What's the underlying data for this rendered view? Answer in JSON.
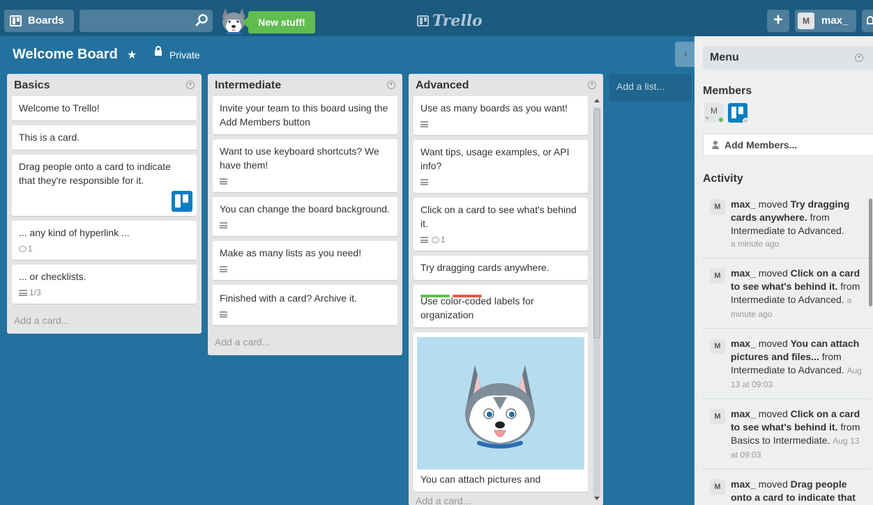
{
  "header": {
    "boards_label": "Boards",
    "new_stuff_label": "New stuff!",
    "logo_text": "Trello",
    "plus_label": "+",
    "user_initial": "M",
    "username": "max_"
  },
  "board": {
    "title": "Welcome Board",
    "star_icon": "★",
    "privacy": "Private",
    "collapse_icon": "›"
  },
  "lists": [
    {
      "title": "Basics",
      "cards": [
        {
          "title": "Welcome to Trello!"
        },
        {
          "title": "This is a card."
        },
        {
          "title": "Drag people onto a card to indicate that they're responsible for it."
        },
        {
          "title": "... any kind of hyperlink ...",
          "comments": "1"
        },
        {
          "title": "... or checklists.",
          "checklist": "1/3"
        }
      ],
      "add_card": "Add a card..."
    },
    {
      "title": "Intermediate",
      "cards": [
        {
          "title": "Invite your team to this board using the Add Members button"
        },
        {
          "title": "Want to use keyboard shortcuts? We have them!"
        },
        {
          "title": "You can change the board background."
        },
        {
          "title": "Make as many lists as you need!"
        },
        {
          "title": "Finished with a card? Archive it."
        }
      ],
      "add_card": "Add a card..."
    },
    {
      "title": "Advanced",
      "cards": [
        {
          "title": "Use as many boards as you want!"
        },
        {
          "title": "Want tips, usage examples, or API info?"
        },
        {
          "title": "Click on a card to see what's behind it.",
          "comments": "1"
        },
        {
          "title": "Try dragging cards anywhere."
        },
        {
          "title": "Use color-coded labels for organization",
          "labels": [
            "#61bd4f",
            "#eb5a46"
          ]
        },
        {
          "title": "You can attach pictures and"
        }
      ],
      "add_card": "Add a card..."
    }
  ],
  "add_list": "Add a list...",
  "sidebar": {
    "menu_title": "Menu",
    "members_title": "Members",
    "member_initial": "M",
    "add_members": "Add Members...",
    "activity_title": "Activity",
    "activities": [
      {
        "user": "max_",
        "action": "moved",
        "card": "Try dragging cards anywhere.",
        "detail": "from Intermediate to Advanced.",
        "time": "a minute ago"
      },
      {
        "user": "max_",
        "action": "moved",
        "card": "Click on a card to see what's behind it.",
        "detail": "from Intermediate to",
        "dest": "Advanced.",
        "time": "a minute ago"
      },
      {
        "user": "max_",
        "action": "moved",
        "card": "You can attach pictures and files...",
        "detail": "from Intermediate to",
        "dest": "Advanced.",
        "time": "Aug 13 at 09:03"
      },
      {
        "user": "max_",
        "action": "moved",
        "card": "Click on a card to see what's behind it.",
        "detail": "from Basics to",
        "dest": "Intermediate.",
        "time": "Aug 13 at 09:03"
      },
      {
        "user": "max_",
        "action": "moved",
        "card": "Drag people onto a card to indicate that they're responsible"
      }
    ]
  },
  "colors": {
    "board_bg": "#23719f",
    "header_bg": "#1c5a80",
    "new_stuff": "#61bd4f",
    "label_green": "#61bd4f",
    "label_red": "#eb5a46",
    "trello_blue": "#0a7ec2"
  }
}
